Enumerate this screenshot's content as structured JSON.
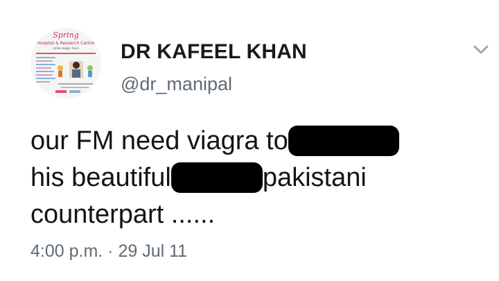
{
  "tweet": {
    "author": {
      "display_name": "DR KAFEEL KHAN",
      "handle": "@dr_manipal",
      "avatar_text": {
        "logo": "Spring",
        "subtitle": "Hospital & Research Centre",
        "tagline": "smile begin here"
      }
    },
    "text_lines": {
      "line1_before": "our FM need viagra to",
      "line2_before": "his beautiful",
      "line2_after": "pakistani",
      "line3": "counterpart ......"
    },
    "timestamp": "4:00 p.m. · 29 Jul 11"
  },
  "colors": {
    "name": "#1a1a1a",
    "secondary": "#5f6b75",
    "body_text": "#141414",
    "redaction": "#000000",
    "chevron": "#9aa4ac"
  },
  "icons": {
    "menu": "chevron-down-icon"
  }
}
